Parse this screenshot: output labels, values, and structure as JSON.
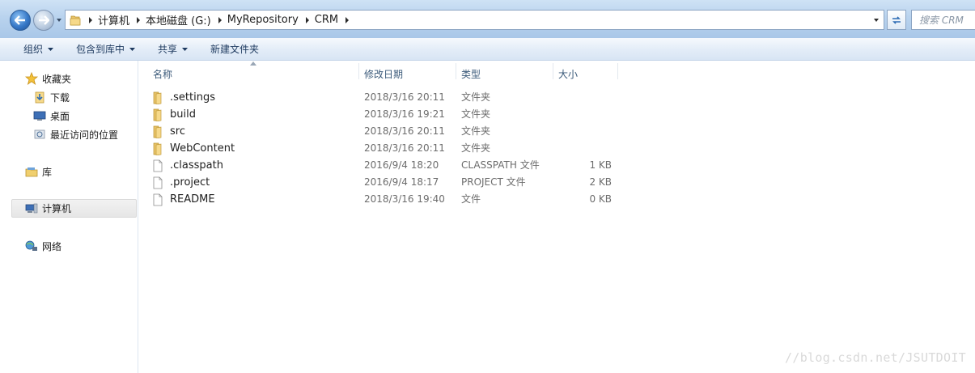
{
  "address": {
    "crumbs": [
      "计算机",
      "本地磁盘 (G:)",
      "MyRepository",
      "CRM"
    ]
  },
  "search": {
    "placeholder": "搜索 CRM"
  },
  "toolbar": {
    "organize": "组织",
    "include_in_library": "包含到库中",
    "share": "共享",
    "new_folder": "新建文件夹"
  },
  "navpane": {
    "favorites": "收藏夹",
    "downloads": "下载",
    "desktop": "桌面",
    "recent": "最近访问的位置",
    "libraries": "库",
    "computer": "计算机",
    "network": "网络"
  },
  "columns": {
    "name": "名称",
    "date_modified": "修改日期",
    "type": "类型",
    "size": "大小"
  },
  "files": [
    {
      "name": ".settings",
      "date": "2018/3/16 20:11",
      "type": "文件夹",
      "size": "",
      "kind": "folder"
    },
    {
      "name": "build",
      "date": "2018/3/16 19:21",
      "type": "文件夹",
      "size": "",
      "kind": "folder"
    },
    {
      "name": "src",
      "date": "2018/3/16 20:11",
      "type": "文件夹",
      "size": "",
      "kind": "folder"
    },
    {
      "name": "WebContent",
      "date": "2018/3/16 20:11",
      "type": "文件夹",
      "size": "",
      "kind": "folder"
    },
    {
      "name": ".classpath",
      "date": "2016/9/4 18:20",
      "type": "CLASSPATH 文件",
      "size": "1 KB",
      "kind": "file"
    },
    {
      "name": ".project",
      "date": "2016/9/4 18:17",
      "type": "PROJECT 文件",
      "size": "2 KB",
      "kind": "file"
    },
    {
      "name": "README",
      "date": "2018/3/16 19:40",
      "type": "文件",
      "size": "0 KB",
      "kind": "file"
    }
  ],
  "watermark": "//blog.csdn.net/JSUTDOIT"
}
